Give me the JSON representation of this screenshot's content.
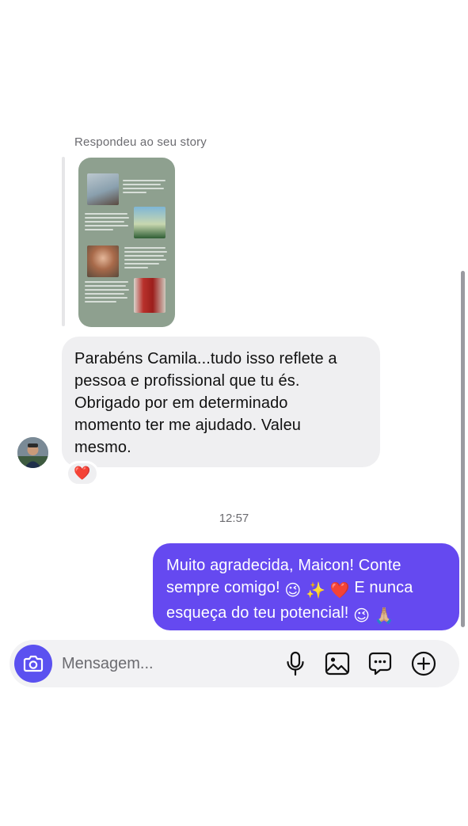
{
  "story": {
    "caption": "Respondeu ao seu story",
    "background_color": "#8ea08f"
  },
  "incoming": {
    "text": "Parabéns Camila...tudo isso reflete a\npessoa e profissional que tu és.\nObrigado  por em determinado\nmomento ter me ajudado. Valeu\nmesmo.",
    "reaction": "❤️",
    "bubble_color": "#efeff1"
  },
  "timestamp": "12:57",
  "outgoing": {
    "line1": "Muito agradecida, Maicon! Conte",
    "line2_a": "sempre comigo! ",
    "emoji_wink": "😉",
    "emoji_sparkles": "✨",
    "emoji_heart": "❤️",
    "line2_b": " E nunca",
    "line3": "esqueça do teu potencial! ",
    "emoji_pray": "🙏🏼",
    "bubble_color": "#6549f0"
  },
  "composer": {
    "placeholder": "Mensagem...",
    "accent": "#5b51f0",
    "icons": [
      "camera-icon",
      "microphone-icon",
      "gallery-icon",
      "sticker-icon",
      "plus-icon"
    ]
  }
}
